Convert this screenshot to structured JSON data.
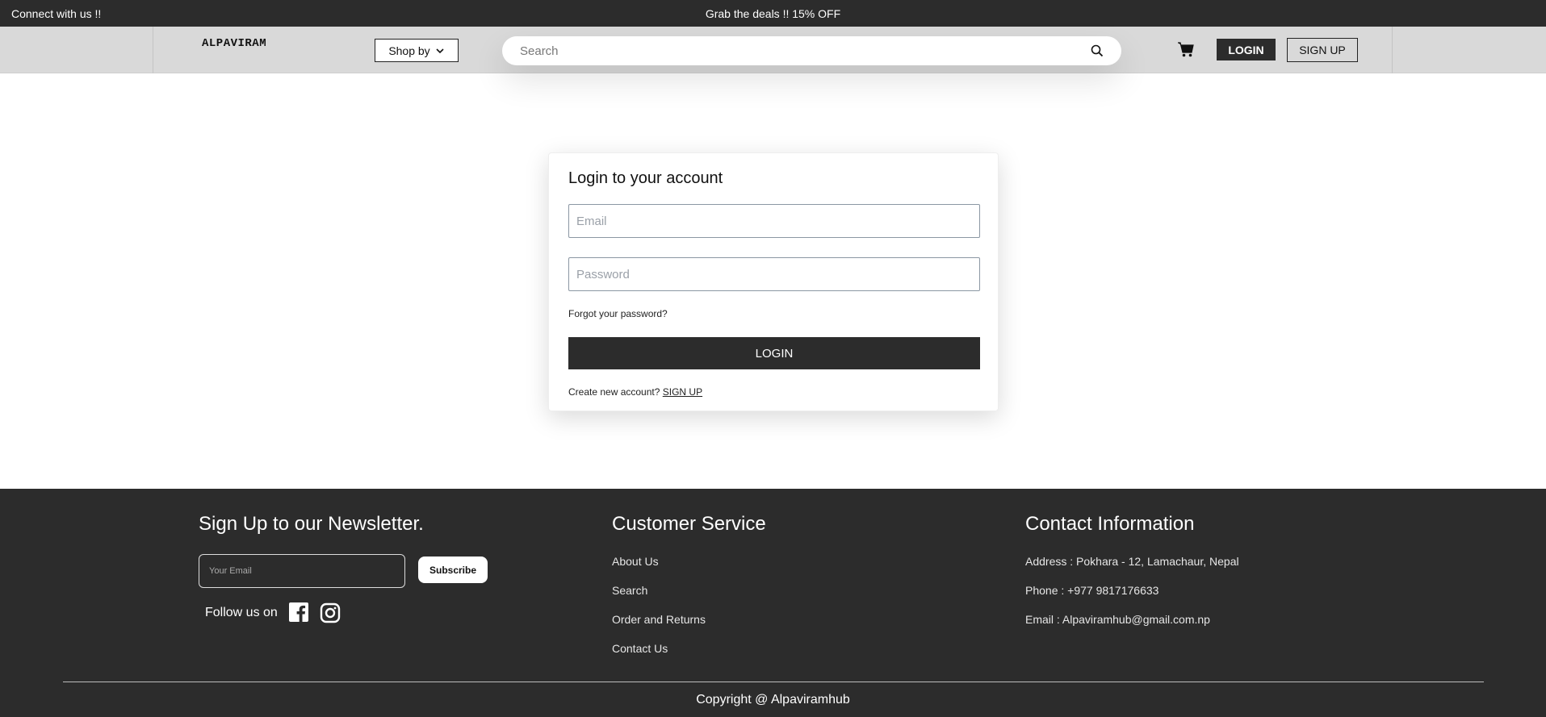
{
  "topbar": {
    "left_text": "Connect with us !!",
    "center_text": "Grab the deals !! 15% OFF"
  },
  "navbar": {
    "logo": "ALPAVIRAM",
    "shop_by_label": "Shop by",
    "search_placeholder": "Search",
    "login_label": "LOGIN",
    "signup_label": "SIGN UP"
  },
  "login_card": {
    "title": "Login to your account",
    "email_placeholder": "Email",
    "password_placeholder": "Password",
    "forgot_text": "Forgot your password?",
    "login_button": "LOGIN",
    "create_prompt": "Create new account?",
    "signup_link": "SIGN UP"
  },
  "footer": {
    "newsletter": {
      "title": "Sign Up to our Newsletter.",
      "email_placeholder": "Your Email",
      "subscribe_label": "Subscribe",
      "follow_text": "Follow us on"
    },
    "customer_service": {
      "title": "Customer Service",
      "links": [
        "About Us",
        "Search",
        "Order and Returns",
        "Contact Us"
      ]
    },
    "contact": {
      "title": "Contact Information",
      "address": "Address : Pokhara - 12, Lamachaur, Nepal",
      "phone": "Phone : +977 9817176633",
      "email": "Email : Alpaviramhub@gmail.com.np"
    },
    "copyright": "Copyright @ Alpaviramhub"
  },
  "colors": {
    "dark": "#2c2c2c",
    "navbar_bg": "#d9d9d9",
    "white": "#ffffff"
  }
}
